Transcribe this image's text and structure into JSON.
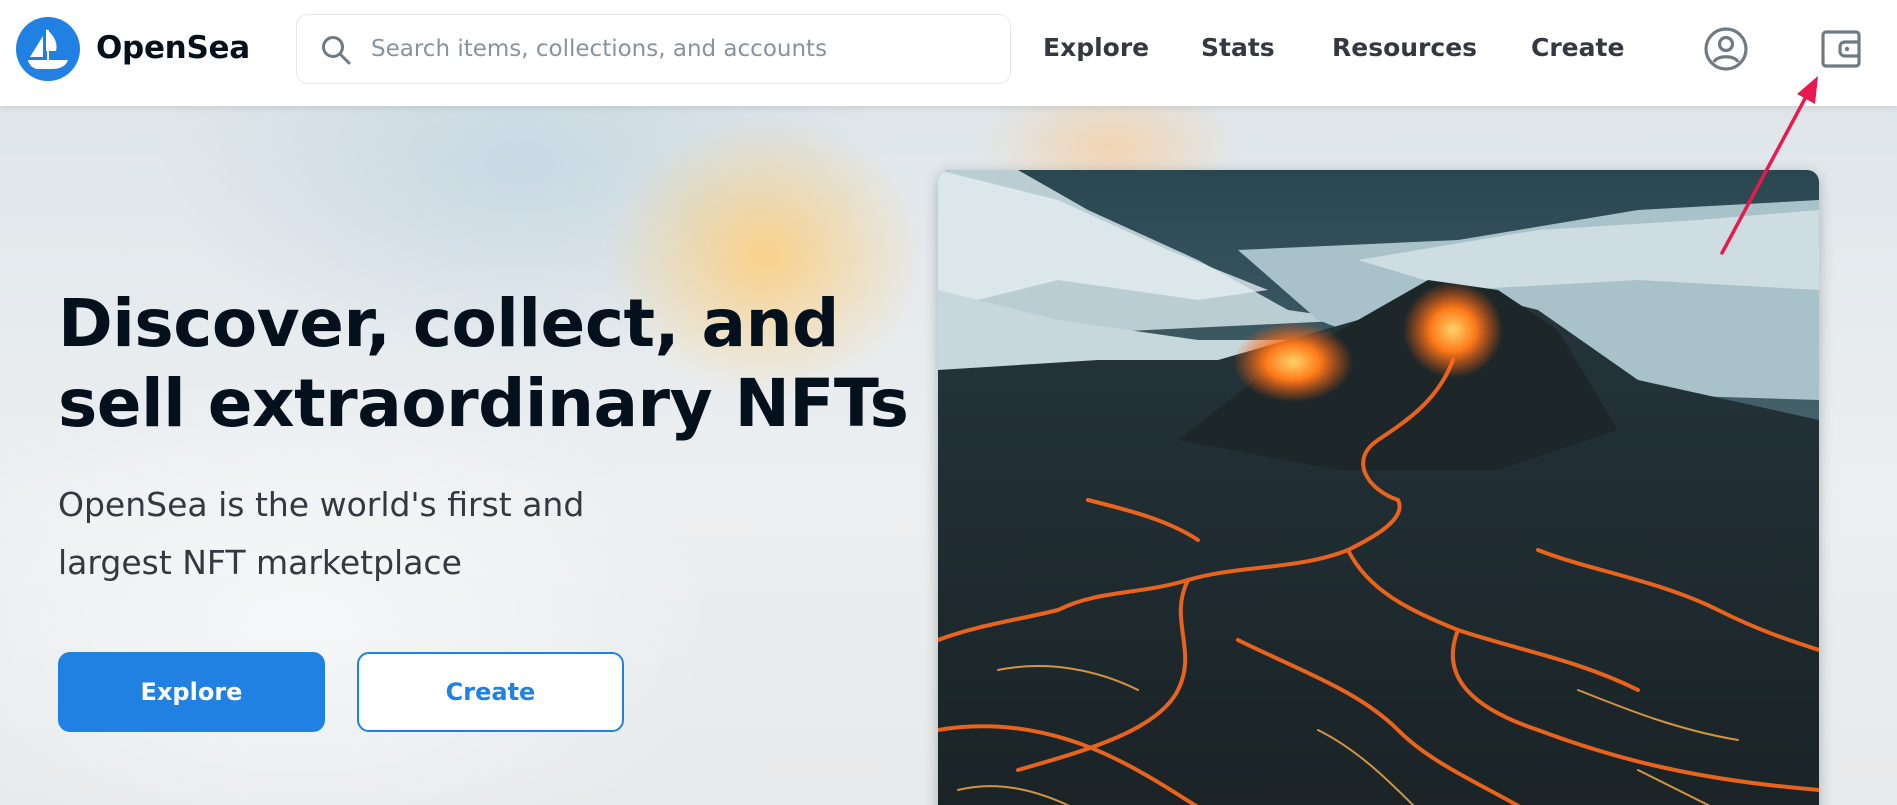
{
  "brand": {
    "name": "OpenSea",
    "logo_icon": "opensea-boat-logo-icon",
    "color": "#2081e2"
  },
  "search": {
    "placeholder": "Search items, collections, and accounts",
    "value": "",
    "icon": "search-icon"
  },
  "nav": {
    "links": [
      {
        "label": "Explore"
      },
      {
        "label": "Stats"
      },
      {
        "label": "Resources"
      },
      {
        "label": "Create"
      }
    ],
    "account_icon": "account-circle-icon",
    "wallet_icon": "wallet-icon"
  },
  "hero": {
    "title": "Discover, collect, and sell extraordinary NFTs",
    "subtitle": "OpenSea is the world's first and largest NFT marketplace",
    "buttons": {
      "primary": "Explore",
      "secondary": "Create"
    },
    "featured_image": "erupting-volcano-lava-flow-image"
  },
  "annotation": {
    "arrow_color": "#e8194f",
    "target": "wallet-icon"
  },
  "colors": {
    "primary": "#2081e2",
    "text": "#04111d",
    "nav_text": "#353840"
  }
}
